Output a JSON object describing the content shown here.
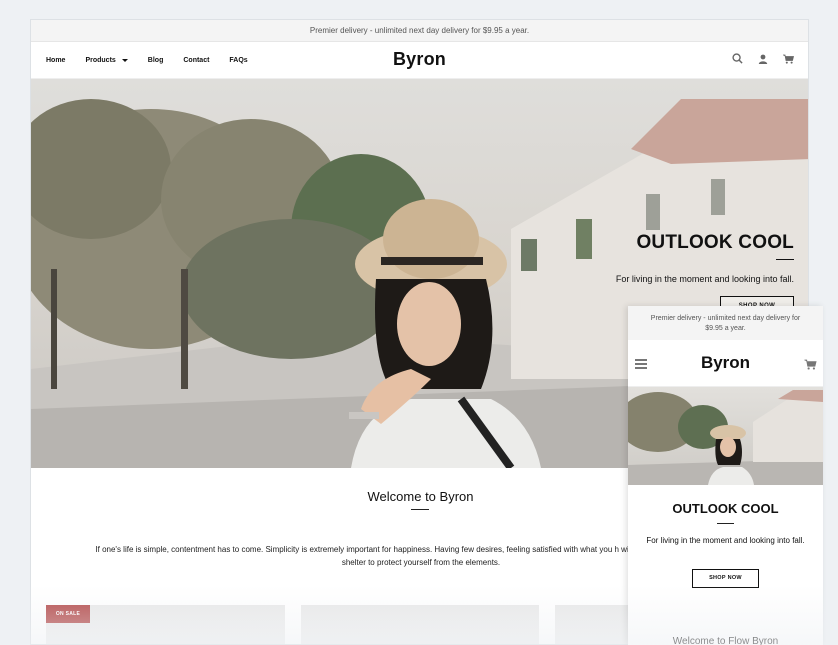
{
  "desktop": {
    "announcement": "Premier delivery - unlimited next day delivery for $9.95 a year.",
    "nav": [
      {
        "label": "Home"
      },
      {
        "label": "Products"
      },
      {
        "label": "Blog"
      },
      {
        "label": "Contact"
      },
      {
        "label": "FAQs"
      }
    ],
    "logo": "Byron",
    "icons": [
      "search-icon",
      "account-icon",
      "cart-icon"
    ],
    "hero": {
      "title": "OUTLOOK COOL",
      "subtitle": "For living in the moment and looking into fall.",
      "button": "SHOP NOW"
    },
    "welcome": {
      "title": "Welcome to Byron",
      "body": "If one's life is simple, contentment has to come. Simplicity is extremely important for happiness. Having few desires, feeling satisfied with what you h with just enough food, clothing, and shelter to protect yourself from the elements."
    },
    "badge": "ON SALE"
  },
  "mobile": {
    "announcement": "Premier delivery - unlimited next day delivery for $9.95 a year.",
    "logo": "Byron",
    "icons": [
      "menu-icon",
      "cart-icon"
    ],
    "hero": {
      "title": "OUTLOOK COOL",
      "subtitle": "For living in the moment and looking into fall.",
      "button": "SHOP NOW"
    },
    "welcome": "Welcome to Flow Byron"
  },
  "colors": {
    "page_bg": "#eef1f4",
    "badge": "#b34a4a",
    "text": "#111111"
  }
}
